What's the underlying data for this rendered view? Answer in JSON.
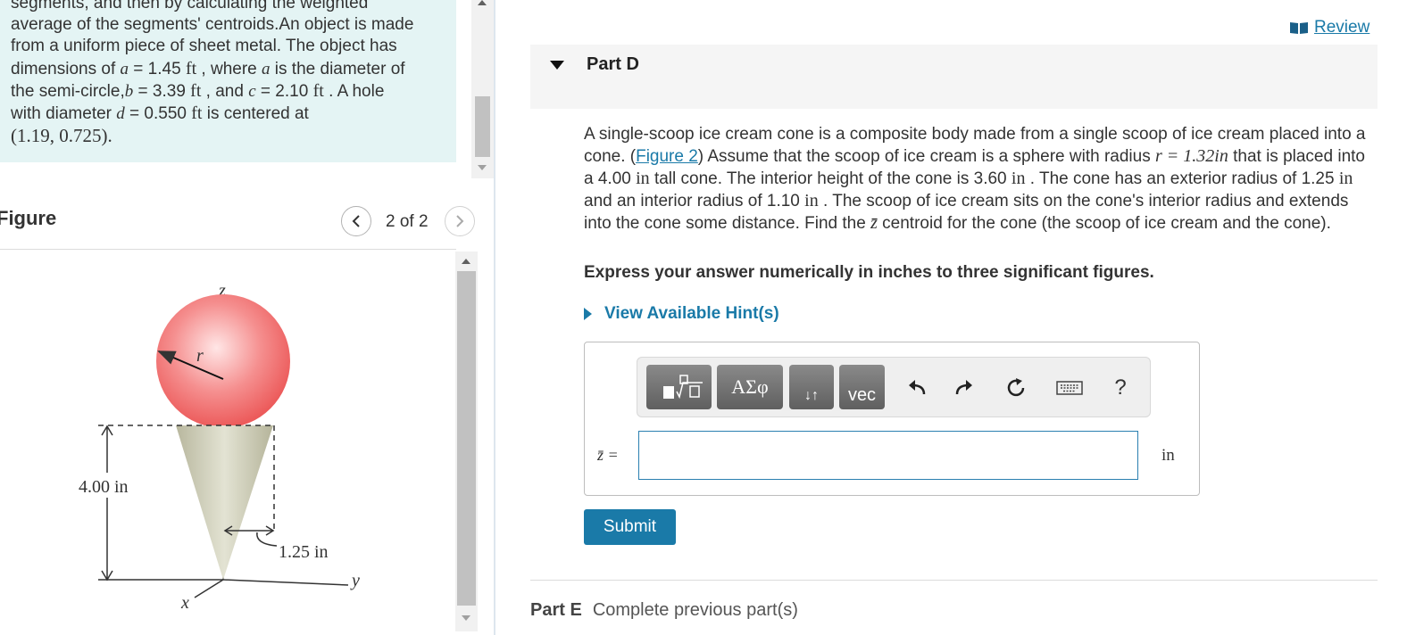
{
  "intro": {
    "line1": "segments, and then by calculating the weighted",
    "line2": "average of the segments' centroids.An object is made",
    "line3": "from a uniform piece of sheet metal. The object has",
    "line4_a": "dimensions of ",
    "line4_var": "a",
    "line4_b": " = 1.45 ",
    "line4_unit": "ft",
    "line4_c": " , where ",
    "line4_var2": "a",
    "line4_d": " is the diameter of",
    "line5_a": "the semi-circle,",
    "line5_var": "b",
    "line5_b": " = 3.39 ",
    "line5_unit": "ft",
    "line5_c": " , and ",
    "line5_var2": "c",
    "line5_d": " = 2.10 ",
    "line5_unit2": "ft",
    "line5_e": " . A hole",
    "line6_a": "with diameter ",
    "line6_var": "d",
    "line6_b": " = 0.550 ",
    "line6_unit": "ft",
    "line6_c": " is centered at",
    "line7": "(1.19, 0.725)."
  },
  "figure": {
    "title": "Figure",
    "counter": "2 of 2",
    "labels": {
      "z": "z",
      "r": "r",
      "height": "4.00 in",
      "radius": "1.25 in",
      "y": "y",
      "x": "x"
    },
    "colors": {
      "scoop": "#f06a6a",
      "cone": "#c9c9b3"
    }
  },
  "review": {
    "label": "Review"
  },
  "partD": {
    "title": "Part D",
    "q1": "A single-scoop ice cream cone is a composite body made from a single scoop of ice cream placed into a cone. (",
    "q_link": "Figure 2",
    "q2": ") Assume that the scoop of ice cream is a sphere with radius ",
    "q_r": "r = 1.32in",
    "q3": " that is placed into a 4.00 ",
    "q_in1": "in",
    "q4": " tall cone. The interior height of the cone is 3.60 ",
    "q_in2": "in",
    "q5": " . The cone has an exterior radius of 1.25 ",
    "q_in3": "in",
    "q6": " and an interior radius of 1.10 ",
    "q_in4": "in",
    "q7": " . The scoop of ice cream sits on the cone's interior radius and extends into the cone some distance. Find the ",
    "q_zbar": "z̄",
    "q8": " centroid for the cone (the scoop of ice cream and the cone).",
    "instruction": "Express your answer numerically in inches to three significant figures.",
    "hints": "View Available Hint(s)",
    "toolbar": {
      "greek": "ΑΣφ",
      "vec": "vec",
      "help": "?",
      "arrows": "↓↑"
    },
    "answer_label": "z̄ =",
    "answer_value": "",
    "unit": "in",
    "submit": "Submit"
  },
  "partE": {
    "title": "Part E",
    "status": "Complete previous part(s)"
  }
}
